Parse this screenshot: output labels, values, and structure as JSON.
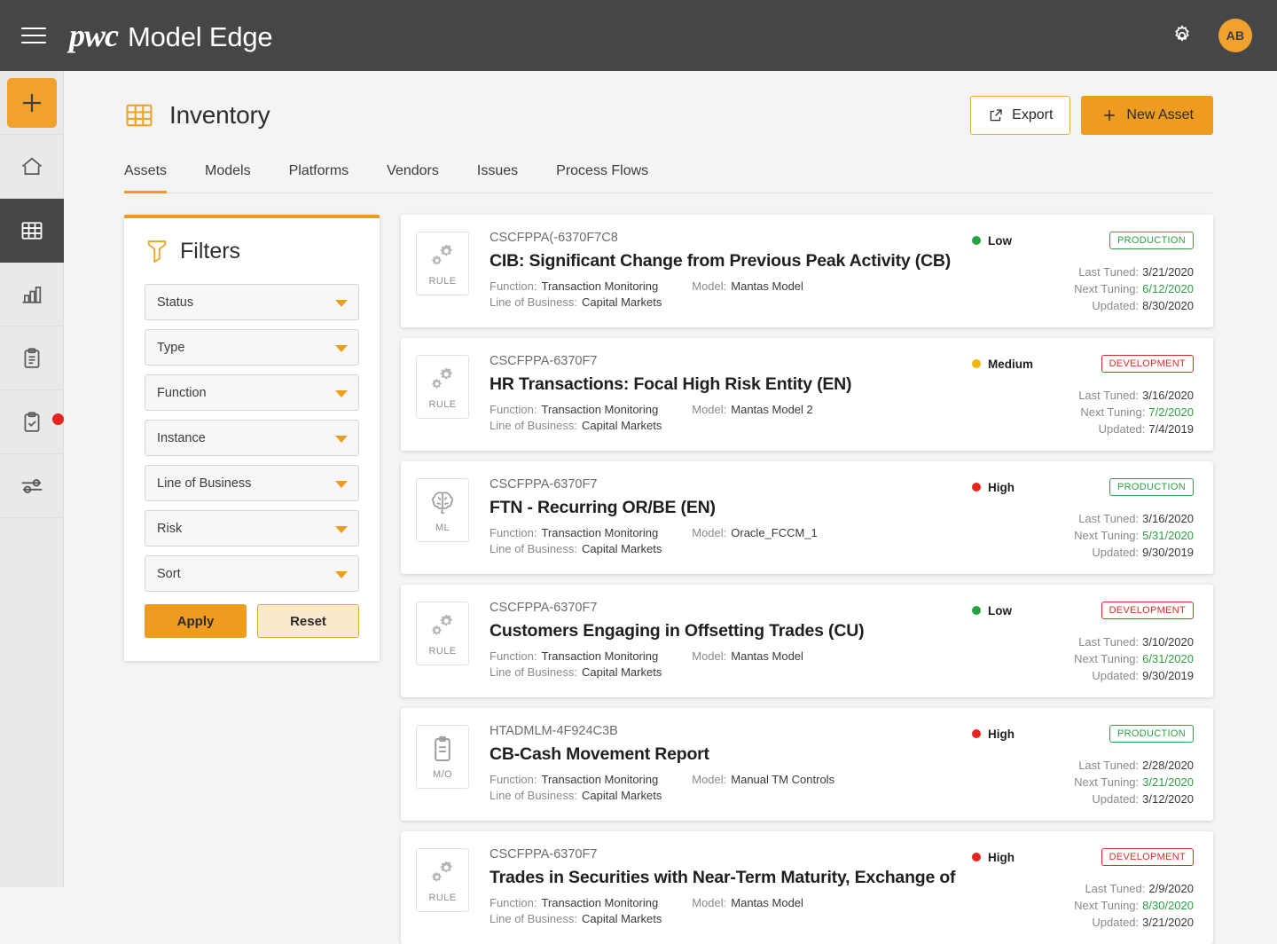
{
  "topbar": {
    "menu_icon": "hamburger-icon",
    "brand_pwc": "pwc",
    "brand_name": "Model Edge",
    "gear_icon": "gear-icon",
    "avatar_initials": "AB"
  },
  "sidebar": {
    "items": [
      {
        "icon": "plus-icon",
        "name": "add"
      },
      {
        "icon": "home-icon",
        "name": "home"
      },
      {
        "icon": "grid-icon",
        "name": "inventory",
        "active": true
      },
      {
        "icon": "bar-chart-icon",
        "name": "analytics"
      },
      {
        "icon": "clipboard-icon",
        "name": "reports"
      },
      {
        "icon": "checklist-icon",
        "name": "tasks",
        "badge": true
      },
      {
        "icon": "sliders-icon",
        "name": "settings"
      }
    ]
  },
  "page": {
    "title": "Inventory",
    "title_icon": "table-grid-icon",
    "export_label": "Export",
    "export_icon": "external-link-icon",
    "new_asset_label": "New Asset",
    "new_asset_icon": "plus-icon",
    "accent_color": "#ee9c20"
  },
  "tabs": [
    {
      "label": "Assets",
      "active": true
    },
    {
      "label": "Models",
      "active": false
    },
    {
      "label": "Platforms",
      "active": false
    },
    {
      "label": "Vendors",
      "active": false
    },
    {
      "label": "Issues",
      "active": false
    },
    {
      "label": "Process Flows",
      "active": false
    }
  ],
  "filters": {
    "title": "Filters",
    "icon": "funnel-icon",
    "dropdowns": [
      {
        "label": "Status"
      },
      {
        "label": "Type"
      },
      {
        "label": "Function"
      },
      {
        "label": "Instance"
      },
      {
        "label": "Line of Business"
      },
      {
        "label": "Risk"
      },
      {
        "label": "Sort"
      }
    ],
    "apply_label": "Apply",
    "reset_label": "Reset"
  },
  "card_labels": {
    "function": "Function:",
    "model": "Model:",
    "line_of_business": "Line of Business:",
    "last_tuned": "Last Tuned:",
    "next_tuning": "Next Tuning:",
    "updated": "Updated:"
  },
  "status_colors": {
    "low": "#25a244",
    "medium": "#f2b705",
    "high": "#e8241f",
    "production": "#2f9e44",
    "development": "#d93025"
  },
  "assets": [
    {
      "id": "CSCFPPA(-6370F7C8",
      "title": "CIB: Significant Change from Previous Peak Activity (CB)",
      "type": "RULE",
      "type_icon": "gears-icon",
      "function": "Transaction Monitoring",
      "model": "Mantas Model",
      "line_of_business": "Capital Markets",
      "risk": "Low",
      "stage": "PRODUCTION",
      "last_tuned": "3/21/2020",
      "next_tuning": "6/12/2020",
      "updated": "8/30/2020"
    },
    {
      "id": "CSCFPPA-6370F7",
      "title": "HR Transactions: Focal High Risk Entity (EN)",
      "type": "RULE",
      "type_icon": "gears-icon",
      "function": "Transaction Monitoring",
      "model": "Mantas Model 2",
      "line_of_business": "Capital Markets",
      "risk": "Medium",
      "stage": "DEVELOPMENT",
      "last_tuned": "3/16/2020",
      "next_tuning": "7/2/2020",
      "updated": "7/4/2019"
    },
    {
      "id": "CSCFPPA-6370F7",
      "title": "FTN - Recurring OR/BE (EN)",
      "type": "ML",
      "type_icon": "brain-icon",
      "function": "Transaction Monitoring",
      "model": "Oracle_FCCM_1",
      "line_of_business": "Capital Markets",
      "risk": "High",
      "stage": "PRODUCTION",
      "last_tuned": "3/16/2020",
      "next_tuning": "5/31/2020",
      "updated": "9/30/2019"
    },
    {
      "id": "CSCFPPA-6370F7",
      "title": "Customers Engaging in Offsetting Trades (CU)",
      "type": "RULE",
      "type_icon": "gears-icon",
      "function": "Transaction Monitoring",
      "model": "Mantas Model",
      "line_of_business": "Capital Markets",
      "risk": "Low",
      "stage": "DEVELOPMENT",
      "last_tuned": "3/10/2020",
      "next_tuning": "6/31/2020",
      "updated": "9/30/2019"
    },
    {
      "id": "HTADMLM-4F924C3B",
      "title": "CB-Cash Movement Report",
      "type": "M/O",
      "type_icon": "document-icon",
      "function": "Transaction Monitoring",
      "model": "Manual TM Controls",
      "line_of_business": "Capital Markets",
      "risk": "High",
      "stage": "PRODUCTION",
      "last_tuned": "2/28/2020",
      "next_tuning": "3/21/2020",
      "updated": "3/12/2020"
    },
    {
      "id": "CSCFPPA-6370F7",
      "title": "Trades in Securities with Near-Term Maturity, Exchange of",
      "type": "RULE",
      "type_icon": "gears-icon",
      "function": "Transaction Monitoring",
      "model": "Mantas Model",
      "line_of_business": "Capital Markets",
      "risk": "High",
      "stage": "DEVELOPMENT",
      "last_tuned": "2/9/2020",
      "next_tuning": "8/30/2020",
      "updated": "3/21/2020"
    }
  ]
}
